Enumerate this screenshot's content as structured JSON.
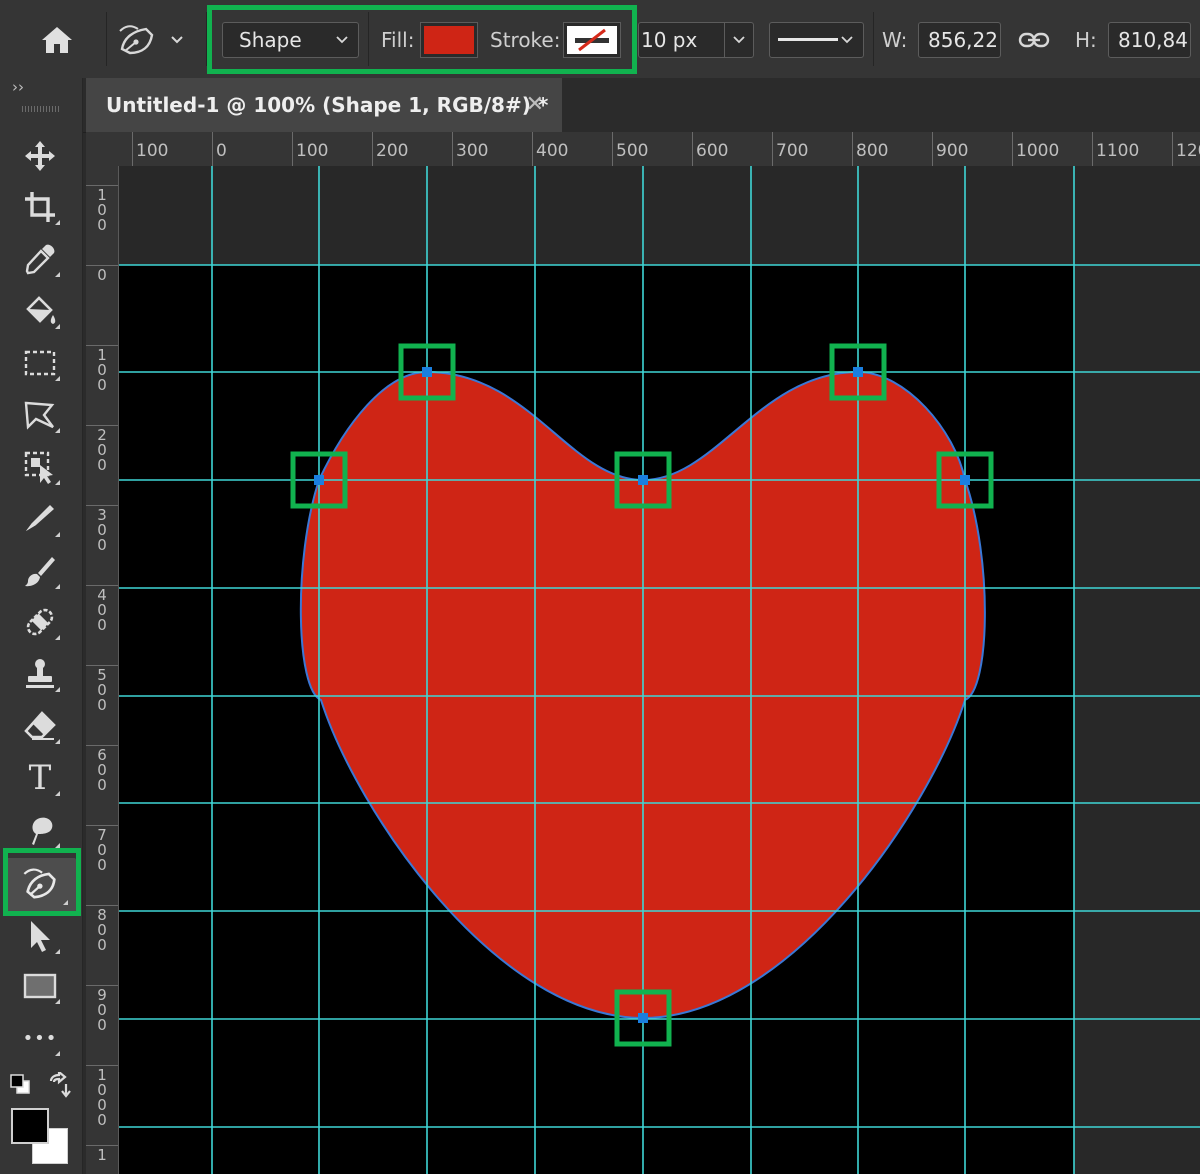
{
  "options_bar": {
    "mode_value": "Shape",
    "fill_label": "Fill:",
    "fill_color": "#cf2515",
    "stroke_label": "Stroke:",
    "stroke_width_value": "10 px",
    "width_label": "W:",
    "width_value": "856,22",
    "height_label": "H:",
    "height_value": "810,84"
  },
  "document": {
    "tab_title": "Untitled-1 @ 100% (Shape 1, RGB/8#) *",
    "close_glyph": "✕"
  },
  "toolbar": {
    "collapse_glyph": "››",
    "tools": [
      {
        "name": "move-tool",
        "icon": "move-icon"
      },
      {
        "name": "crop-tool",
        "icon": "crop-icon"
      },
      {
        "name": "eyedropper-tool",
        "icon": "eyedropper-icon"
      },
      {
        "name": "paint-bucket-tool",
        "icon": "paint-bucket-icon"
      },
      {
        "name": "rectangular-marquee-tool",
        "icon": "marquee-icon"
      },
      {
        "name": "lasso-tool",
        "icon": "lasso-icon"
      },
      {
        "name": "object-selection-tool",
        "icon": "object-selection-icon"
      },
      {
        "name": "healing-tool",
        "icon": "healing-icon"
      },
      {
        "name": "brush-tool",
        "icon": "brush-icon"
      },
      {
        "name": "spot-healing-tool",
        "icon": "bandage-icon"
      },
      {
        "name": "clone-stamp-tool",
        "icon": "stamp-icon"
      },
      {
        "name": "eraser-tool",
        "icon": "eraser-icon"
      },
      {
        "name": "type-tool",
        "icon": "type-icon"
      },
      {
        "name": "smudge-tool",
        "icon": "smudge-icon"
      },
      {
        "name": "curvature-pen-tool",
        "icon": "curvature-pen-icon",
        "active": true
      },
      {
        "name": "path-selection-tool",
        "icon": "arrow-icon"
      },
      {
        "name": "rectangle-tool",
        "icon": "rectangle-icon"
      },
      {
        "name": "more-tools",
        "icon": "ellipsis-icon"
      }
    ],
    "type_glyph": "T",
    "more_glyph": "•••",
    "foreground_color": "#000000",
    "background_color": "#ffffff"
  },
  "rulers": {
    "horizontal": [
      "100",
      "0",
      "100",
      "200",
      "300",
      "400",
      "500",
      "600",
      "700",
      "800",
      "900",
      "1000",
      "1100",
      "120"
    ],
    "vertical": [
      "100",
      "0",
      "100",
      "200",
      "300",
      "400",
      "500",
      "600",
      "700",
      "800",
      "900",
      "1000",
      "1"
    ]
  },
  "canvas": {
    "guide_color": "#3fd6d6",
    "shape_fill": "#cf2515",
    "path_color": "#3a78d6",
    "anchor_color": "#1a7fe0",
    "highlight_color": "#11b24f"
  }
}
